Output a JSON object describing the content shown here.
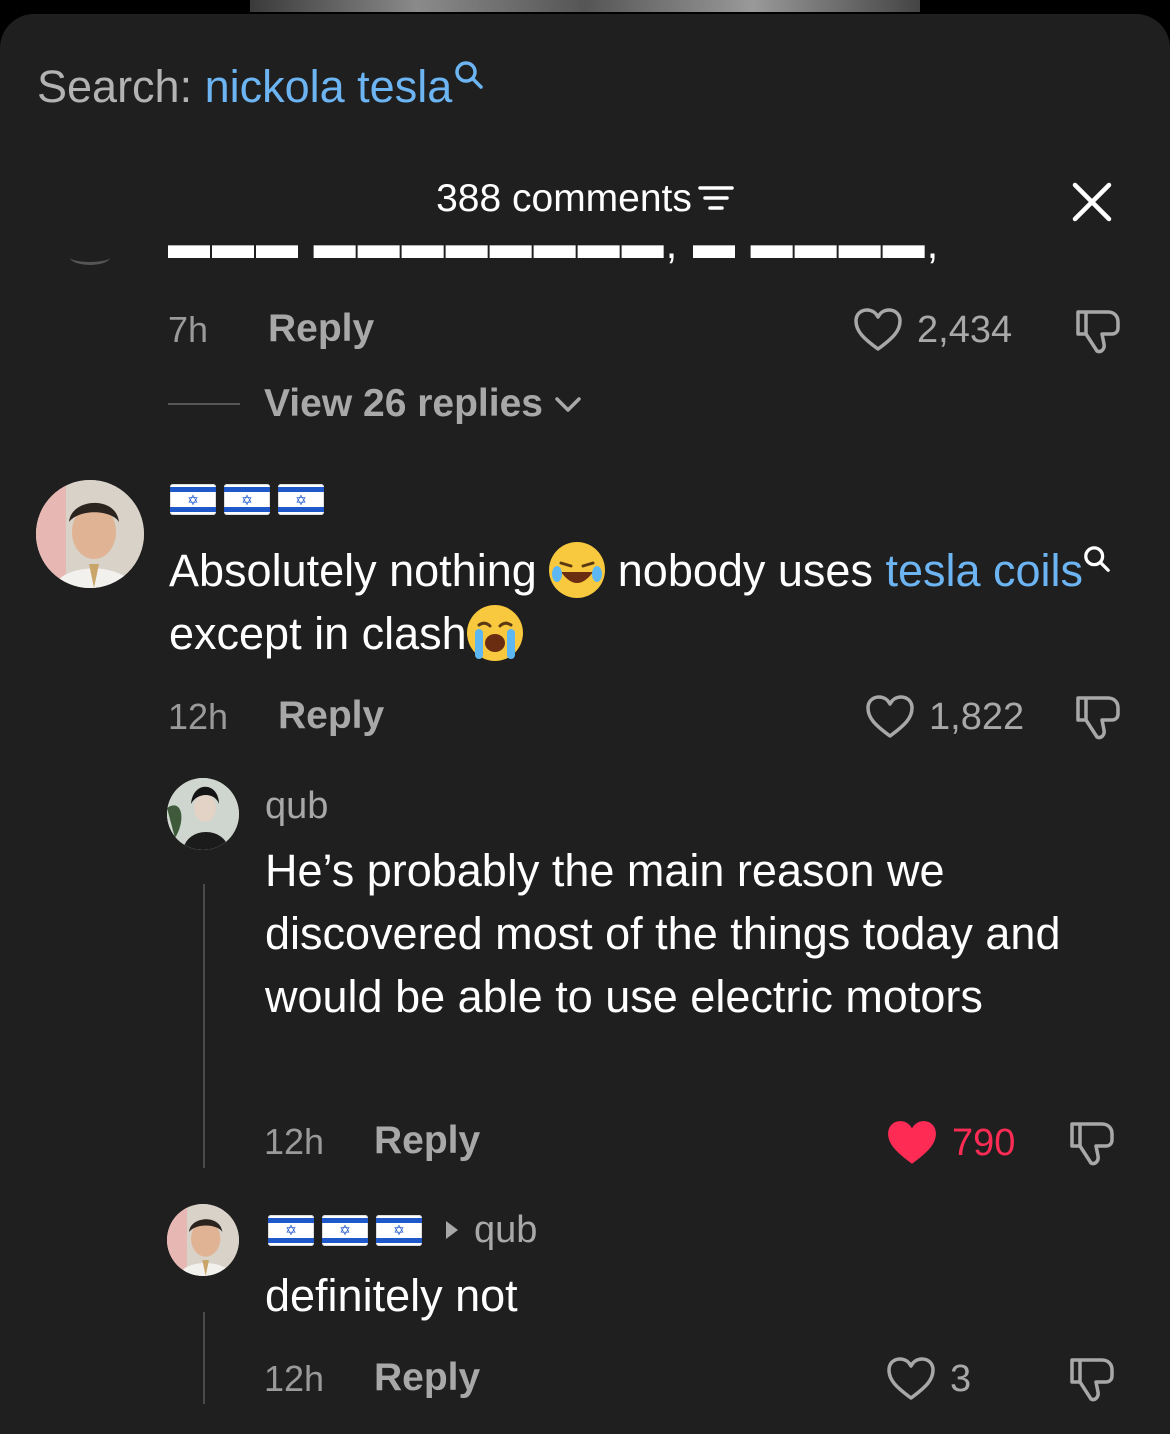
{
  "search": {
    "label": "Search: ",
    "query": "nickola tesla"
  },
  "header": {
    "count": "388 comments"
  },
  "comments": [
    {
      "time": "7h",
      "reply": "Reply",
      "likes": "2,434",
      "view_replies": "View 26 replies"
    },
    {
      "user": "🇮🇱🇮🇱🇮🇱",
      "text_a": "Absolutely nothing ",
      "text_b": " nobody uses ",
      "link": "tesla coils",
      "text_c": " except in clash",
      "time": "12h",
      "reply": "Reply",
      "likes": "1,822"
    }
  ],
  "replies": [
    {
      "user": "qub",
      "text": "He’s probably the main reason we discovered most of the things today and would be able to use electric motors",
      "time": "12h",
      "reply": "Reply",
      "likes": "790",
      "liked": true
    },
    {
      "user": "🇮🇱🇮🇱🇮🇱",
      "reply_to": "qub",
      "text": "definitely not",
      "time": "12h",
      "reply": "Reply",
      "likes": "3"
    }
  ],
  "colors": {
    "link": "#6cb4f2",
    "liked": "#fe2c55",
    "background": "#1f1f20"
  },
  "icons": [
    "search-icon",
    "sort-icon",
    "close-icon",
    "heart-icon",
    "dislike-icon",
    "chevron-down-icon",
    "laughing-emoji",
    "crying-emoji"
  ]
}
